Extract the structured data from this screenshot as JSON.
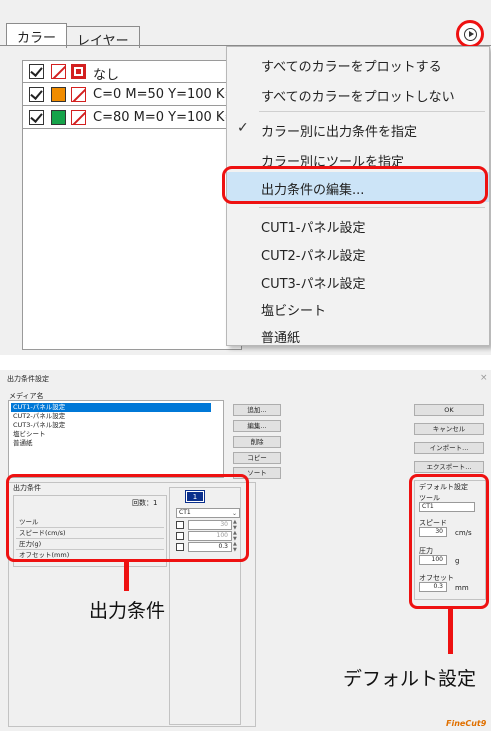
{
  "top": {
    "tabs": [
      {
        "label": "カラー"
      },
      {
        "label": "レイヤー"
      }
    ],
    "colors": [
      {
        "label": "なし"
      },
      {
        "label": "C=0 M=50 Y=100 K=",
        "swatch": "#f08c00"
      },
      {
        "label": "C=80 M=0 Y=100 K=",
        "swatch": "#16a34a"
      }
    ],
    "menu": [
      {
        "label": "すべてのカラーをプロットする"
      },
      {
        "label": "すべてのカラーをプロットしない"
      },
      {
        "label": "カラー別に出力条件を指定",
        "checked": "✓"
      },
      {
        "label": "カラー別にツールを指定"
      },
      {
        "label": "出力条件の編集..."
      },
      {
        "label": "CUT1-パネル設定"
      },
      {
        "label": "CUT2-パネル設定"
      },
      {
        "label": "CUT3-パネル設定"
      },
      {
        "label": "塩ビシート"
      },
      {
        "label": "普通紙"
      }
    ]
  },
  "dialog": {
    "title": "出力条件設定",
    "close": "×",
    "media_header": "メディア名",
    "media": [
      "CUT1-パネル設定",
      "CUT2-パネル設定",
      "CUT3-パネル設定",
      "塩ビシート",
      "普通紙"
    ],
    "mid_buttons": [
      "追加...",
      "編集...",
      "削除",
      "コピー",
      "ソート"
    ],
    "right_buttons": [
      "OK",
      "キャンセル",
      "インポート...",
      "エクスポート..."
    ],
    "cond_title": "出力条件",
    "count_label": "回数：1",
    "tab_num": "1",
    "fields": [
      "ツール",
      "スピード(cm/s)",
      "圧力(g)",
      "オフセット(mm)"
    ],
    "tool_value": "CT1",
    "speed_value": "30",
    "pressure_value": "100",
    "offset_value": "0.3",
    "defaults": {
      "title": "デフォルト設定",
      "tool_label": "ツール",
      "tool_value": "CT1",
      "speed_label": "スピード",
      "speed_value": "30",
      "speed_unit": "cm/s",
      "pressure_label": "圧力",
      "pressure_value": "100",
      "pressure_unit": "g",
      "offset_label": "オフセット",
      "offset_value": "0.3",
      "offset_unit": "mm"
    },
    "callout_left": "出力条件",
    "callout_right": "デフォルト設定",
    "logo": "FineCut9"
  },
  "colors": {
    "accent_red": "#e11111",
    "selection": "#0078d7",
    "menu_highlight": "#cce4f7"
  }
}
